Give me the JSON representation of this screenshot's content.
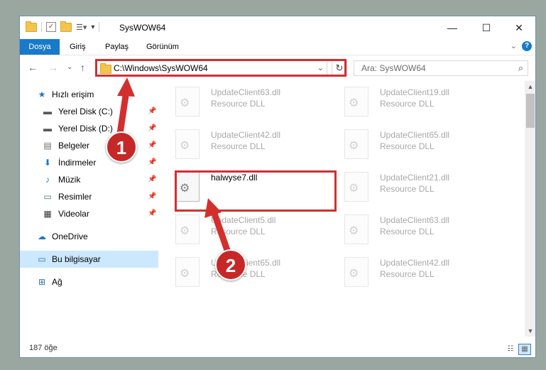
{
  "window": {
    "title": "SysWOW64"
  },
  "ribbon": {
    "tabs": [
      "Dosya",
      "Giriş",
      "Paylaş",
      "Görünüm"
    ],
    "help_label": "?"
  },
  "address": {
    "path": "C:\\Windows\\SysWOW64"
  },
  "search": {
    "placeholder": "Ara: SysWOW64"
  },
  "navpane": {
    "quick_access": "Hızlı erişim",
    "pinned": [
      "Yerel Disk (C:)",
      "Yerel Disk (D:)",
      "Belgeler",
      "İndirmeler",
      "Müzik",
      "Resimler",
      "Videolar"
    ],
    "onedrive": "OneDrive",
    "this_pc": "Bu bilgisayar",
    "network": "Ağ"
  },
  "files": {
    "left": [
      {
        "name": "UpdateClient63.dll",
        "desc": "Resource DLL"
      },
      {
        "name": "UpdateClient42.dll",
        "desc": "Resource DLL"
      },
      {
        "name": "halwyse7.dll",
        "desc": ""
      },
      {
        "name": "UpdateClient5.dll",
        "desc": "Resource DLL"
      },
      {
        "name": "UpdateClient65.dll",
        "desc": "Resource DLL"
      }
    ],
    "right": [
      {
        "name": "UpdateClient19.dll",
        "desc": "Resource DLL"
      },
      {
        "name": "UpdateClient65.dll",
        "desc": "Resource DLL"
      },
      {
        "name": "UpdateClient21.dll",
        "desc": "Resource DLL"
      },
      {
        "name": "UpdateClient63.dll",
        "desc": "Resource DLL"
      },
      {
        "name": "UpdateClient42.dll",
        "desc": "Resource DLL"
      }
    ]
  },
  "status": {
    "count": "187 öğe"
  },
  "annotations": {
    "step1": "1",
    "step2": "2"
  },
  "colors": {
    "accent": "#1979ca",
    "callout": "#d32f2f",
    "selection": "#cce8ff"
  }
}
